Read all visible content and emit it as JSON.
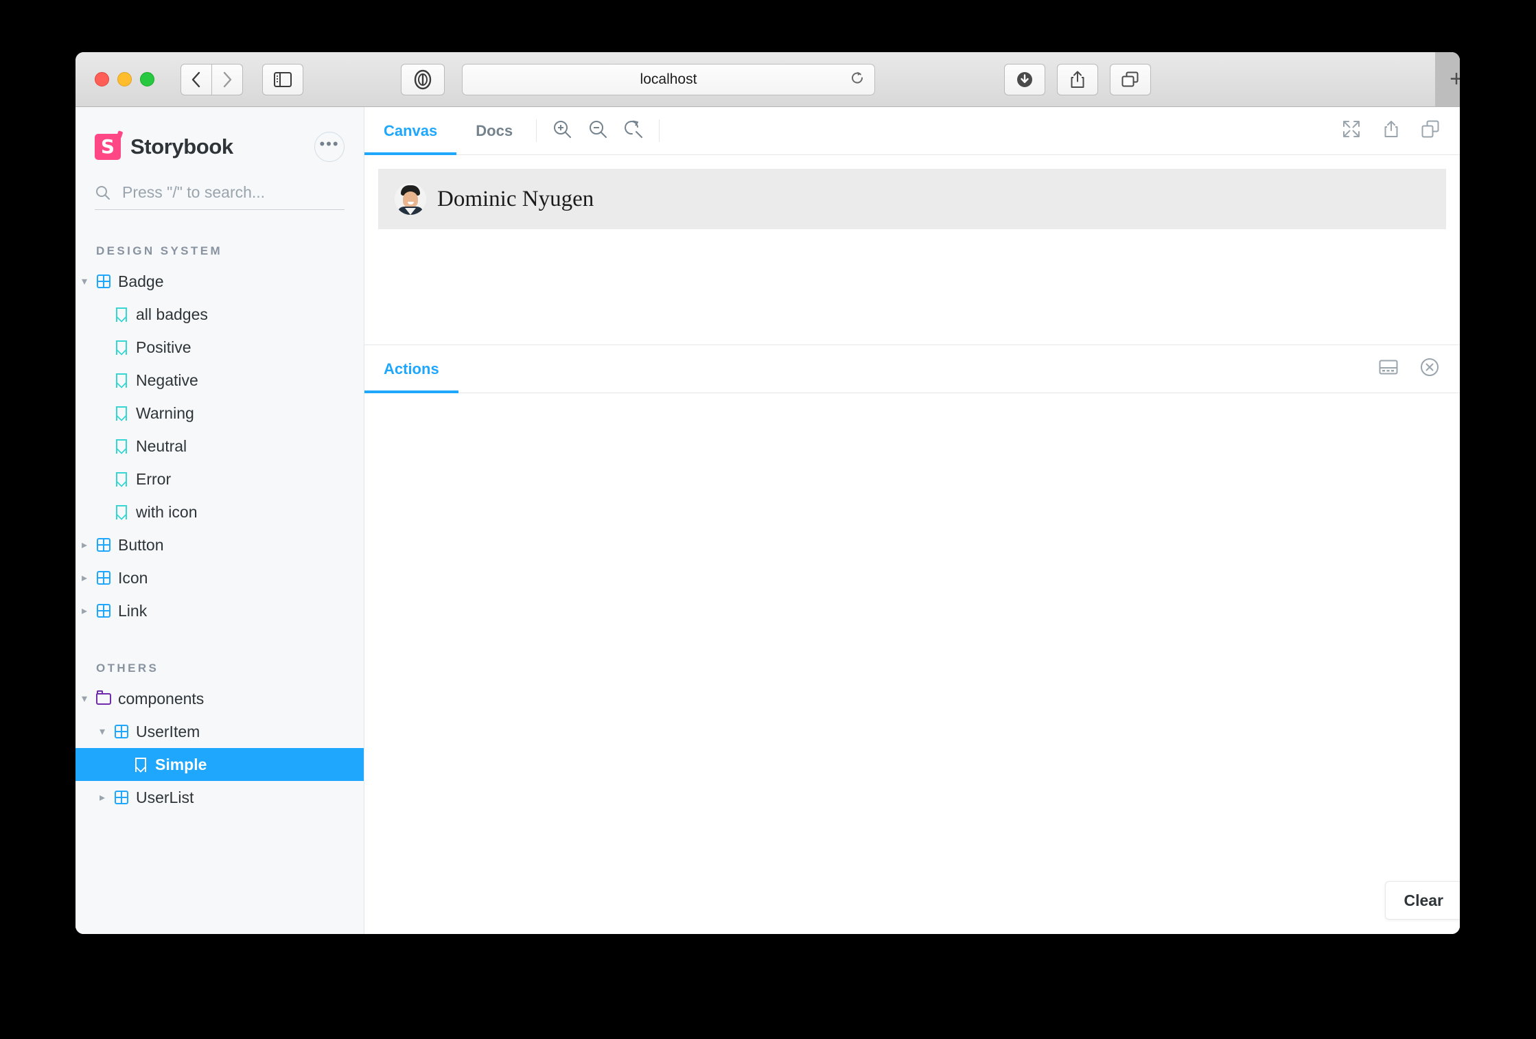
{
  "browser": {
    "url": "localhost",
    "traffic_lights": [
      "close-red",
      "minimize-yellow",
      "maximize-green"
    ],
    "back_icon": "chevron-left-icon",
    "forward_icon": "chevron-right-icon",
    "sidebar_icon": "sidebar-toggle-icon",
    "reader_icon": "reader-mode-icon",
    "reload_icon": "reload-icon",
    "downloads_icon": "downloads-icon",
    "share_icon": "share-icon",
    "tabs_overview_icon": "tab-overview-icon",
    "new_tab_label": "+"
  },
  "sidebar": {
    "brand": "Storybook",
    "logo_icon": "storybook-logo-icon",
    "menu_icon": "ellipsis-icon",
    "search": {
      "icon": "search-icon",
      "placeholder": "Press \"/\" to search...",
      "value": ""
    },
    "sections": [
      {
        "label": "DESIGN SYSTEM",
        "items": [
          {
            "label": "Badge",
            "type": "component",
            "depth": 0,
            "state": "expanded",
            "icon": "component-grid-icon",
            "caret": "caret-down-icon"
          },
          {
            "label": "all badges",
            "type": "story",
            "depth": 1,
            "state": "none",
            "icon": "story-bookmark-icon"
          },
          {
            "label": "Positive",
            "type": "story",
            "depth": 1,
            "state": "none",
            "icon": "story-bookmark-icon"
          },
          {
            "label": "Negative",
            "type": "story",
            "depth": 1,
            "state": "none",
            "icon": "story-bookmark-icon"
          },
          {
            "label": "Warning",
            "type": "story",
            "depth": 1,
            "state": "none",
            "icon": "story-bookmark-icon"
          },
          {
            "label": "Neutral",
            "type": "story",
            "depth": 1,
            "state": "none",
            "icon": "story-bookmark-icon"
          },
          {
            "label": "Error",
            "type": "story",
            "depth": 1,
            "state": "none",
            "icon": "story-bookmark-icon"
          },
          {
            "label": "with icon",
            "type": "story",
            "depth": 1,
            "state": "none",
            "icon": "story-bookmark-icon"
          },
          {
            "label": "Button",
            "type": "component",
            "depth": 0,
            "state": "collapsed",
            "icon": "component-grid-icon",
            "caret": "caret-right-icon"
          },
          {
            "label": "Icon",
            "type": "component",
            "depth": 0,
            "state": "collapsed",
            "icon": "component-grid-icon",
            "caret": "caret-right-icon"
          },
          {
            "label": "Link",
            "type": "component",
            "depth": 0,
            "state": "collapsed",
            "icon": "component-grid-icon",
            "caret": "caret-right-icon"
          }
        ]
      },
      {
        "label": "OTHERS",
        "items": [
          {
            "label": "components",
            "type": "folder",
            "depth": 0,
            "state": "expanded",
            "icon": "folder-icon",
            "caret": "caret-down-icon"
          },
          {
            "label": "UserItem",
            "type": "component",
            "depth": 1,
            "state": "expanded",
            "icon": "component-grid-icon",
            "caret": "caret-down-icon"
          },
          {
            "label": "Simple",
            "type": "story",
            "depth": 2,
            "state": "selected",
            "icon": "story-bookmark-icon",
            "selected": true
          },
          {
            "label": "UserList",
            "type": "component",
            "depth": 1,
            "state": "collapsed",
            "icon": "component-grid-icon",
            "caret": "caret-right-icon"
          }
        ]
      }
    ]
  },
  "main": {
    "tabs": [
      {
        "label": "Canvas",
        "active": true
      },
      {
        "label": "Docs",
        "active": false
      }
    ],
    "zoom_tools": [
      {
        "icon": "zoom-in-icon"
      },
      {
        "icon": "zoom-out-icon"
      },
      {
        "icon": "zoom-reset-icon"
      }
    ],
    "right_tools": [
      {
        "icon": "fullscreen-icon"
      },
      {
        "icon": "open-in-new-tab-icon"
      },
      {
        "icon": "copy-link-icon"
      }
    ],
    "story_preview": {
      "avatar_icon": "user-avatar-photo",
      "name": "Dominic Nyugen"
    }
  },
  "panel": {
    "tabs": [
      {
        "label": "Actions",
        "active": true
      }
    ],
    "tools": [
      {
        "icon": "panel-position-icon"
      },
      {
        "icon": "close-circle-icon"
      }
    ],
    "clear_label": "Clear",
    "log_entries": []
  },
  "colors": {
    "accent_blue": "#1ea7fd",
    "brand_pink": "#ff4785",
    "story_teal": "#37d5d3",
    "folder_purple": "#6f2cac",
    "sidebar_bg": "#f6f8fa",
    "canvas_band": "#ebebeb"
  }
}
